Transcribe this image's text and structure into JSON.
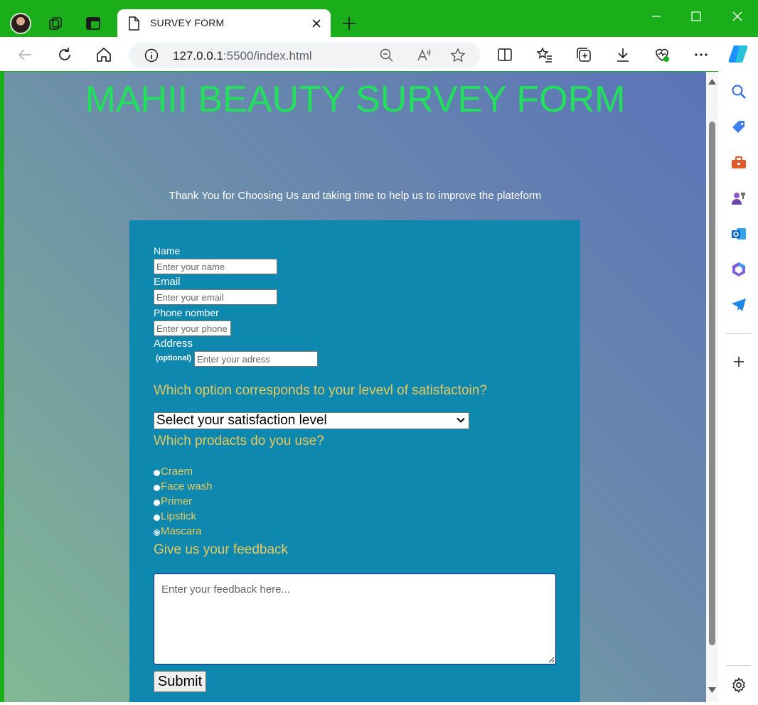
{
  "browser": {
    "tab_title": "SURVEY FORM",
    "url_host": "127.0.0.1",
    "url_rest": ":5500/index.html"
  },
  "page": {
    "title": "MAHII BEAUTY SURVEY FORM",
    "subtitle": "Thank You for Choosing Us and taking time to help us to improve the plateform"
  },
  "form": {
    "name": {
      "label": "Name",
      "placeholder": "Enter your name"
    },
    "email": {
      "label": "Email",
      "placeholder": "Enter your email"
    },
    "phone": {
      "label": "Phone nomber",
      "placeholder": "Enter your phone"
    },
    "address": {
      "label": "Address",
      "note": "(optional)",
      "placeholder": "Enter your adress"
    },
    "satisfaction": {
      "question": "Which option corresponds to your levevl of satisfactoin?",
      "selected": "Select your satisfaction level"
    },
    "products": {
      "question": "Which prodacts do you use?",
      "options": [
        "Craem",
        "Face wash",
        "Primer",
        "Lipstick",
        "Mascara"
      ]
    },
    "feedback": {
      "question": "Give us your feedback",
      "placeholder": "Enter your feedback here..."
    },
    "submit_label": "Submit"
  },
  "colors": {
    "browser_frame": "#1aaf1a",
    "title": "#22e05c",
    "card": "#0f88b0",
    "question": "#e8c95a"
  }
}
